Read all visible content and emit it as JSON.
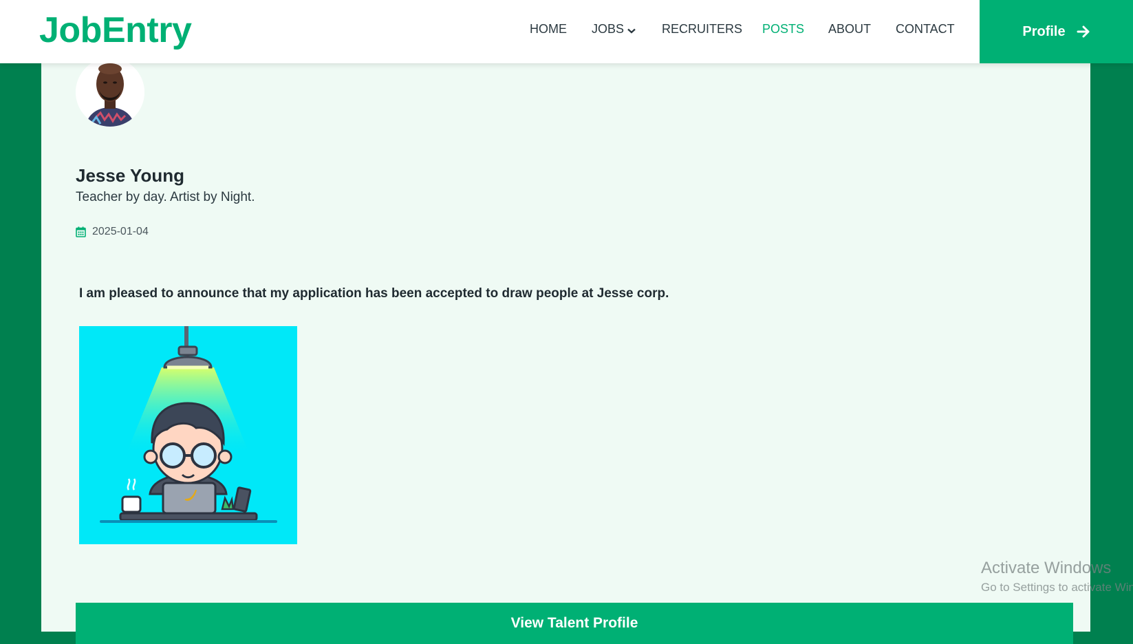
{
  "header": {
    "brand": "JobEntry",
    "nav": [
      {
        "label": "HOME"
      },
      {
        "label": "JOBS"
      },
      {
        "label": "RECRUITERS"
      },
      {
        "label": "POSTS",
        "active": true
      },
      {
        "label": "ABOUT"
      },
      {
        "label": "CONTACT"
      }
    ],
    "profile_label": "Profile"
  },
  "post": {
    "author_name": "Jesse Young",
    "author_bio": "Teacher by day. Artist by Night.",
    "date": "2025-01-04",
    "text": "I am pleased to announce that my application has been accepted to draw people at Jesse corp.",
    "cta_label": "View Talent Profile"
  },
  "watermark": {
    "title": "Activate Windows",
    "subtitle": "Go to Settings to activate Windows."
  },
  "colors": {
    "accent": "#00b074",
    "page_background": "#00804f",
    "card_background": "#effaf4"
  }
}
